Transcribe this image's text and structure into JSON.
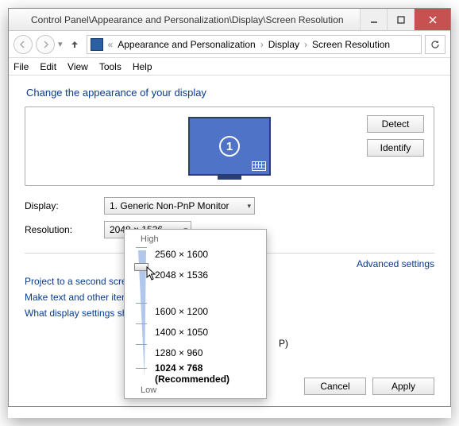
{
  "window": {
    "title": "Control Panel\\Appearance and Personalization\\Display\\Screen Resolution"
  },
  "breadcrumb": {
    "seg1": "Appearance and Personalization",
    "seg2": "Display",
    "seg3": "Screen Resolution"
  },
  "menu": {
    "file": "File",
    "edit": "Edit",
    "view": "View",
    "tools": "Tools",
    "help": "Help"
  },
  "heading": "Change the appearance of your display",
  "monitor_number": "1",
  "buttons": {
    "detect": "Detect",
    "identify": "Identify",
    "cancel": "Cancel",
    "apply": "Apply"
  },
  "labels": {
    "display": "Display:",
    "resolution": "Resolution:"
  },
  "display_combo": "1. Generic Non-PnP Monitor",
  "resolution_combo": "2048 × 1536",
  "advanced_link": "Advanced settings",
  "links": {
    "project": "Project to a second screen (or press the Windows logo key + P)",
    "text": "Make text and other items larger or smaller",
    "what": "What display settings should I choose?"
  },
  "popup": {
    "high": "High",
    "low": "Low",
    "resolutions": [
      "2560 × 1600",
      "2048 × 1536",
      "1600 × 1200",
      "1400 × 1050",
      "1280 × 960",
      "1024 × 768 (Recommended)"
    ]
  }
}
